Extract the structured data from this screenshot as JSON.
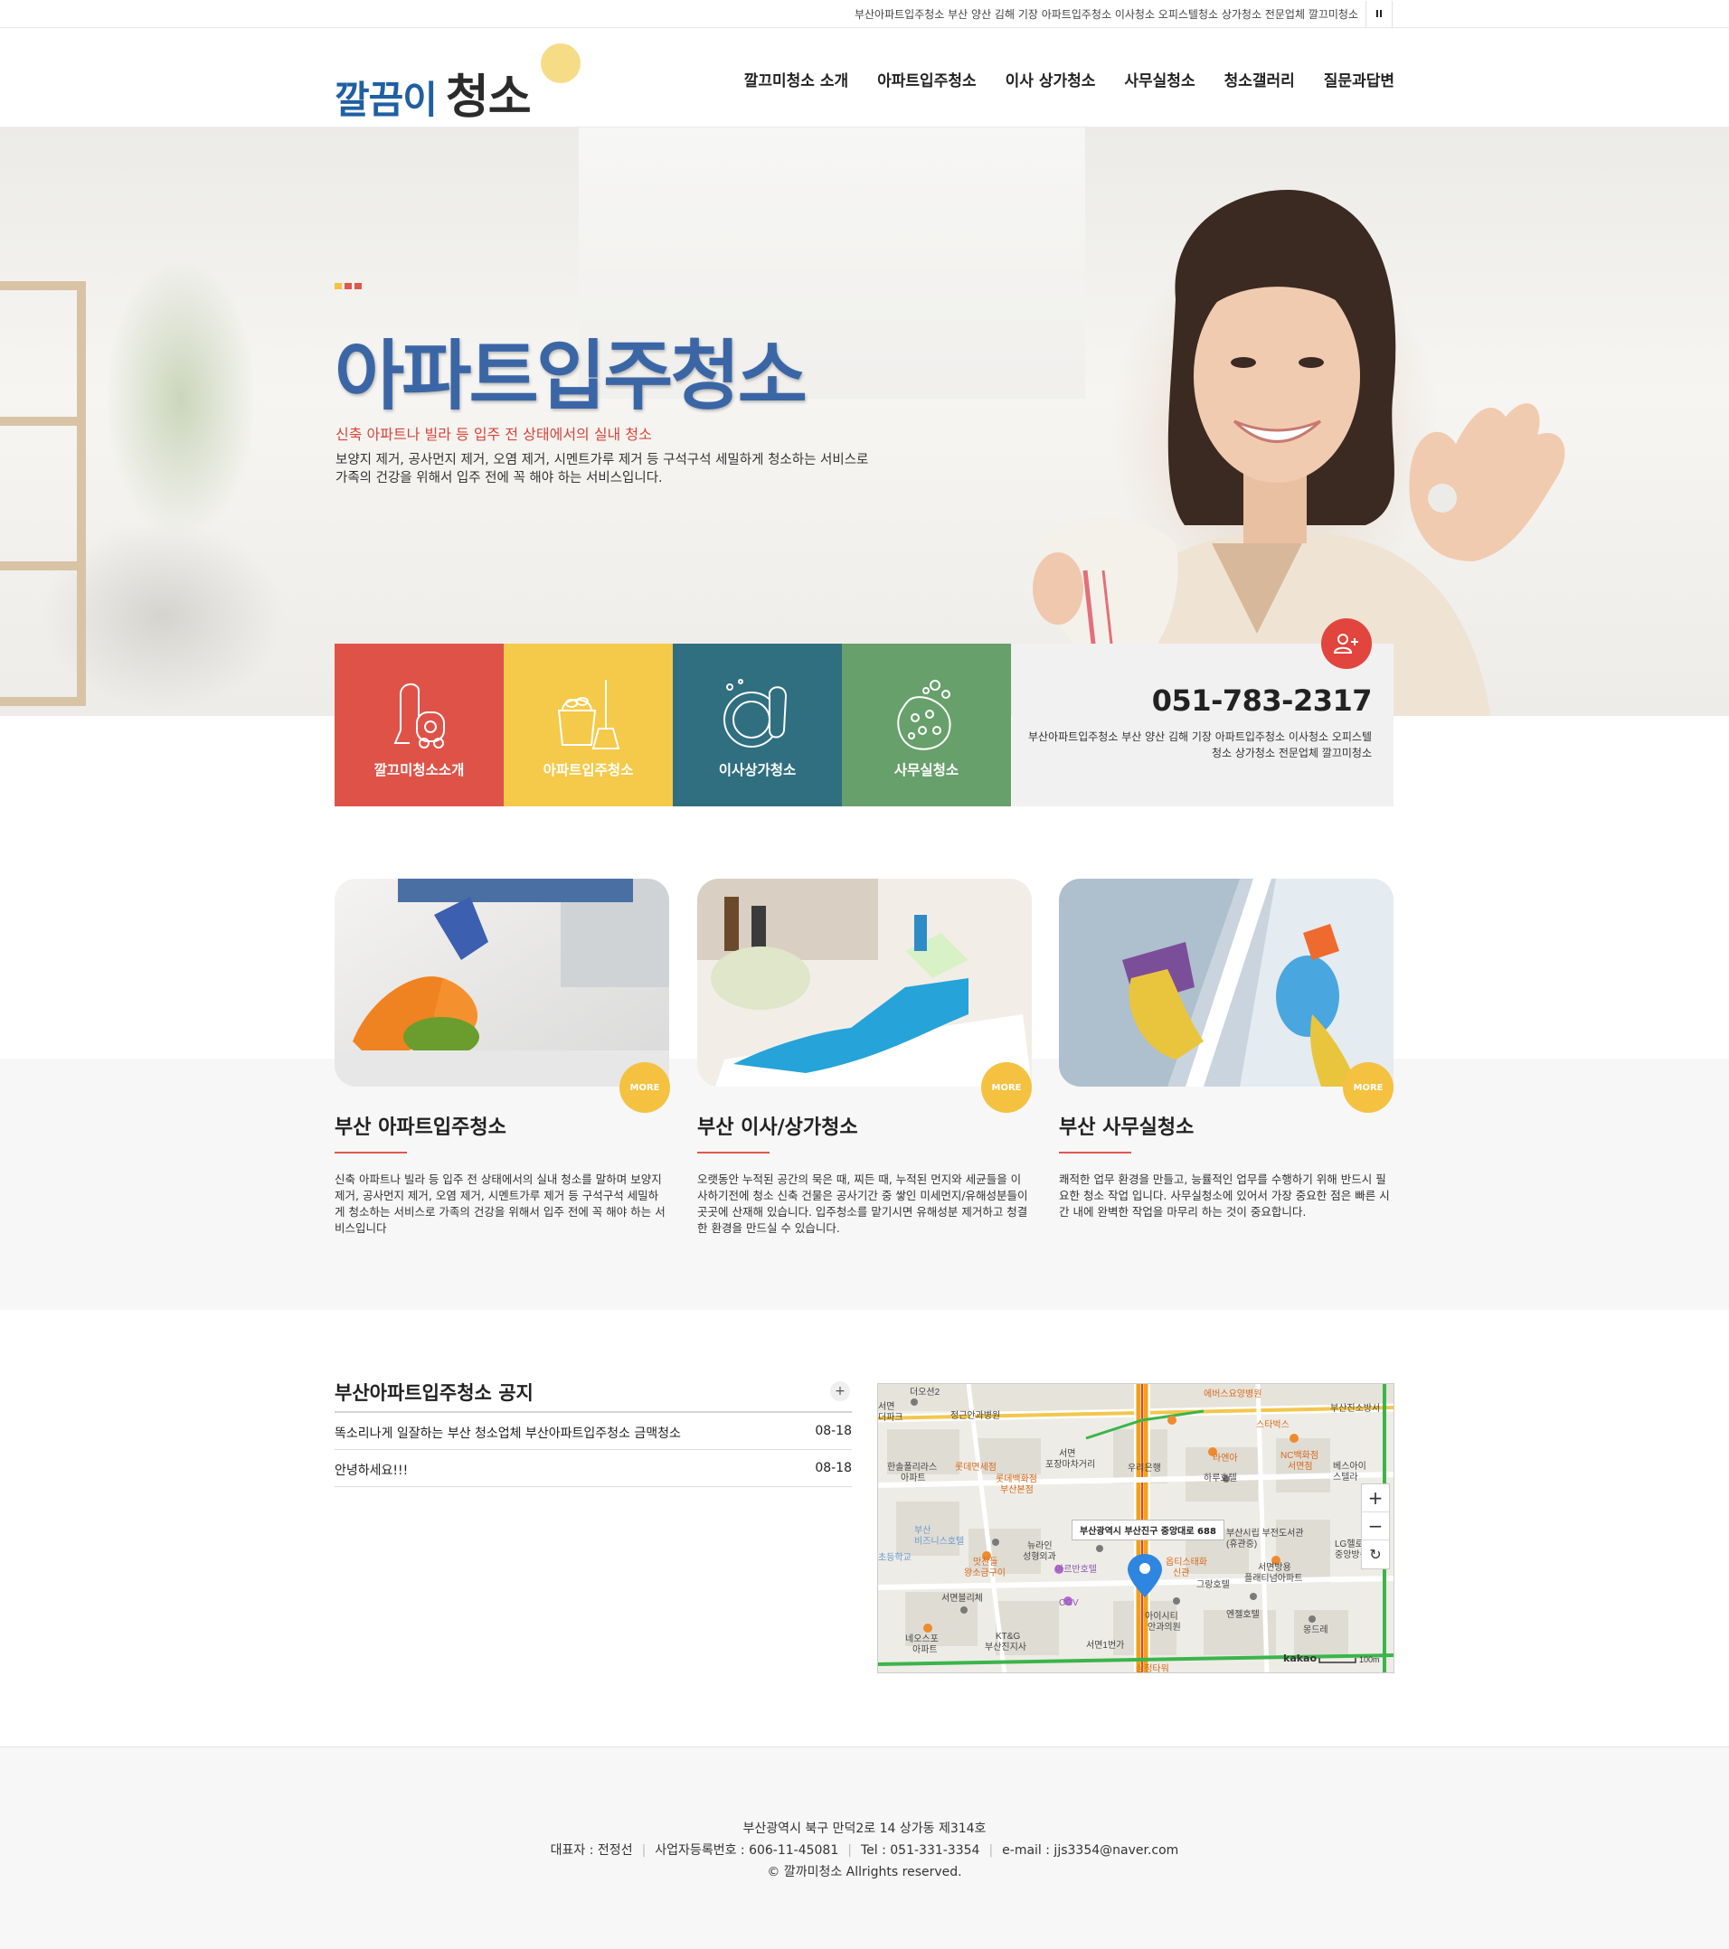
{
  "topbar": {
    "text": "부산아파트입주청소 부산 양산 김해 기장 아파트입주청소 이사청소 오피스텔청소 상가청소 전문업체 깔끄미청소",
    "pause_label": "II"
  },
  "header": {
    "logo_part1": "깔끔이",
    "logo_part2": "청소",
    "nav": [
      "깔끄미청소 소개",
      "아파트입주청소",
      "이사 상가청소",
      "사무실청소",
      "청소갤러리",
      "질문과답변"
    ]
  },
  "hero": {
    "title": "아파트입주청소",
    "subtitle": "신축 아파트나 빌라 등 입주 전 상태에서의 실내 청소",
    "description": "보양지 제거, 공사먼지 제거, 오염 제거, 시멘트가루 제거 등 구석구석 세밀하게 청소하는 서비스로 가족의 건강을 위해서 입주 전에 꼭 해야 하는 서비스입니다.",
    "deco_colors": [
      "#f5c141",
      "#e0574e",
      "#e0574e"
    ]
  },
  "quick_menu": [
    {
      "label": "깔끄미청소소개",
      "color": "#df5248",
      "icon": "vacuum-icon"
    },
    {
      "label": "아파트입주청소",
      "color": "#f5c94a",
      "icon": "bucket-broom-icon"
    },
    {
      "label": "이사상가청소",
      "color": "#2f6f80",
      "icon": "plate-sponge-icon"
    },
    {
      "label": "사무실청소",
      "color": "#67a06b",
      "icon": "sponge-bubbles-icon"
    }
  ],
  "contact": {
    "phone": "051-783-2317",
    "description": "부산아파트입주청소 부산 양산 김해 기장 아파트입주청소 이사청소 오피스텔청소 상가청소 전문업체 깔끄미청소",
    "icon": "add-user-icon"
  },
  "services": [
    {
      "title": "부산 아파트입주청소",
      "more": "MORE",
      "text": "신축 아파트나 빌라 등 입주 전 상태에서의 실내 청소를 말하며 보양지 제거, 공사먼지 제거, 오염 제거, 시멘트가루 제거 등 구석구석 세밀하게 청소하는 서비스로 가족의 건강을 위해서 입주 전에 꼭 해야 하는 서비스입니다"
    },
    {
      "title": "부산 이사/상가청소",
      "more": "MORE",
      "text": "오랫동안 누적된 공간의 묵은 때, 찌든 때, 누적된 먼지와 세균들을 이사하기전에 청소 신축 건물은 공사기간 중 쌓인 미세먼지/유해성분들이 곳곳에 산재해 있습니다. 입주청소를 맡기시면 유해성분 제거하고 청결한 환경을 만드실 수 있습니다."
    },
    {
      "title": "부산 사무실청소",
      "more": "MORE",
      "text": "쾌적한 업무 환경을 만들고, 능률적인 업무를 수행하기 위해 반드시 필요한 청소 작업 입니다. 사무실청소에 있어서 가장 중요한 점은 빠른 시간 내에 완벽한 작업을 마무리 하는 것이 중요합니다."
    }
  ],
  "notice": {
    "title": "부산아파트입주청소 공지",
    "plus": "+",
    "items": [
      {
        "title": "똑소리나게 일잘하는 부산 청소업체 부산아파트입주청소 금맥청소",
        "date": "08-18"
      },
      {
        "title": "안녕하세요!!!",
        "date": "08-18"
      }
    ]
  },
  "map": {
    "address_label": "부산광역시 부산진구 중앙대로 688",
    "zoom_in": "+",
    "zoom_out": "−",
    "reset": "↻",
    "brand": "kakao",
    "scale": "100m",
    "places": [
      "더오션2",
      "서면 더파크",
      "정근안과병원",
      "에버스요양병원",
      "부산진소방서",
      "한솔폴리라스 아파트",
      "롯데면세점",
      "롯데백화점 부산본점",
      "서면 포장마차거리",
      "우리은행",
      "라엔아",
      "NC백화점 서면점",
      "베스아이 스텔라",
      "하루호텔",
      "스타벅스",
      "부산 비즈니스호텔",
      "맛찬들 왕소금구이",
      "뉴라인 성형외과",
      "부산시립 부전도서관 (휴관중)",
      "LG헬로 중앙방송",
      "스타벅스",
      "아르반호텔",
      "그랑호텔",
      "서면방용 플래티넘아파트",
      "CGV",
      "서면블리체",
      "아이시티 안과의원",
      "엔젤호텔",
      "몽드레",
      "네오스포 아파트",
      "KT&G 부산진지사",
      "서면1번가",
      "삼정타워",
      "초등학교"
    ]
  },
  "footer": {
    "address": "부산광역시 북구 만덕2로 14 상가동 제314호",
    "ceo": "대표자 : 전정선",
    "biz_no": "사업자등록번호 : 606-11-45081",
    "tel": "Tel : 051-331-3354",
    "email": "e-mail : jjs3354@naver.com",
    "copyright": "© 깔까미청소 Allrights reserved."
  }
}
